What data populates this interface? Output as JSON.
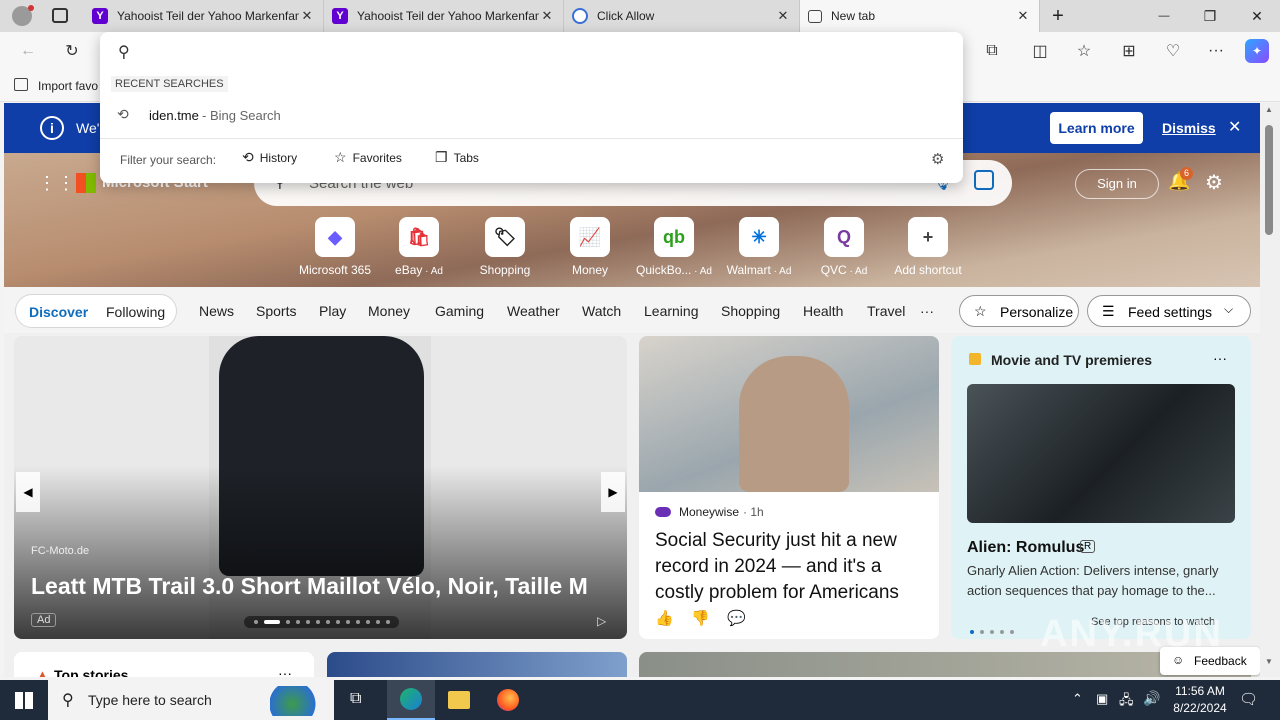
{
  "tabs": [
    {
      "title": "Yahooist Teil der Yahoo Markenfamilie",
      "close": "✕"
    },
    {
      "title": "Yahooist Teil der Yahoo Markenfamilie",
      "close": "✕"
    },
    {
      "title": "Click Allow",
      "close": "✕"
    },
    {
      "title": "New tab",
      "close": "✕"
    }
  ],
  "window": {
    "minimize": "—",
    "restore": "❐",
    "close": "✕",
    "new_tab": "+"
  },
  "favorites_bar": {
    "import_label": "Import favo"
  },
  "omnibox": {
    "recent_header": "RECENT SEARCHES",
    "recent_item": {
      "query": "iden.tme",
      "source": " - Bing Search"
    },
    "filter_label": "Filter your search:",
    "filters": [
      "History",
      "Favorites",
      "Tabs"
    ]
  },
  "banner": {
    "text": "We'",
    "learn_more": "Learn more",
    "dismiss": "Dismiss"
  },
  "header": {
    "logo": "Microsoft Start",
    "search_placeholder": "Search the web",
    "sign_in": "Sign in",
    "notif_count": "6"
  },
  "quick_links": [
    {
      "label": "Microsoft 365",
      "ad": "",
      "icon": "m365-icon",
      "glyph": "◆"
    },
    {
      "label": "eBay",
      "ad": " · Ad",
      "icon": "ebay-icon",
      "glyph": "🛍"
    },
    {
      "label": "Shopping",
      "ad": "",
      "icon": "tag-icon",
      "glyph": "🏷"
    },
    {
      "label": "Money",
      "ad": "",
      "icon": "chart-icon",
      "glyph": "📈"
    },
    {
      "label": "QuickBo...",
      "ad": " · Ad",
      "icon": "quickbooks-icon",
      "glyph": "qb"
    },
    {
      "label": "Walmart",
      "ad": " · Ad",
      "icon": "walmart-icon",
      "glyph": "✳"
    },
    {
      "label": "QVC",
      "ad": " · Ad",
      "icon": "qvc-icon",
      "glyph": "Q"
    },
    {
      "label": "Add shortcut",
      "ad": "",
      "icon": "plus-icon",
      "glyph": "+"
    }
  ],
  "feed_tabs": {
    "discover": "Discover",
    "following": "Following"
  },
  "nav_items": [
    "News",
    "Sports",
    "Play",
    "Money",
    "Gaming",
    "Weather",
    "Watch",
    "Learning",
    "Shopping",
    "Health",
    "Travel"
  ],
  "nav_more": "···",
  "personalize": "Personalize",
  "feed_settings": "Feed settings",
  "ad_card": {
    "source": "FC-Moto.de",
    "title": "Leatt MTB Trail 3.0 Short Maillot Vélo, Noir, Taille M",
    "ad_label": "Ad"
  },
  "news_card": {
    "source": "Moneywise",
    "time": " · 1h",
    "title": "Social Security just hit a new record in 2024 — and it's a costly problem for Americans"
  },
  "movie_card": {
    "section": "Movie and TV premieres",
    "title": "Alien: Romulus",
    "rating": "R",
    "desc": "Gnarly Alien Action: Delivers intense, gnarly action sequences that pay homage to the...",
    "link": "See top reasons to watch"
  },
  "bottom": {
    "top_stories": "Top stories",
    "feedback": "Feedback"
  },
  "watermark": "ANY.RUN",
  "taskbar": {
    "search_placeholder": "Type here to search",
    "time": "11:56 AM",
    "date": "8/22/2024"
  },
  "colors": {
    "banner": "#0f3ea8",
    "accent": "#0f6cbd",
    "taskbar": "#1f2a3a"
  }
}
